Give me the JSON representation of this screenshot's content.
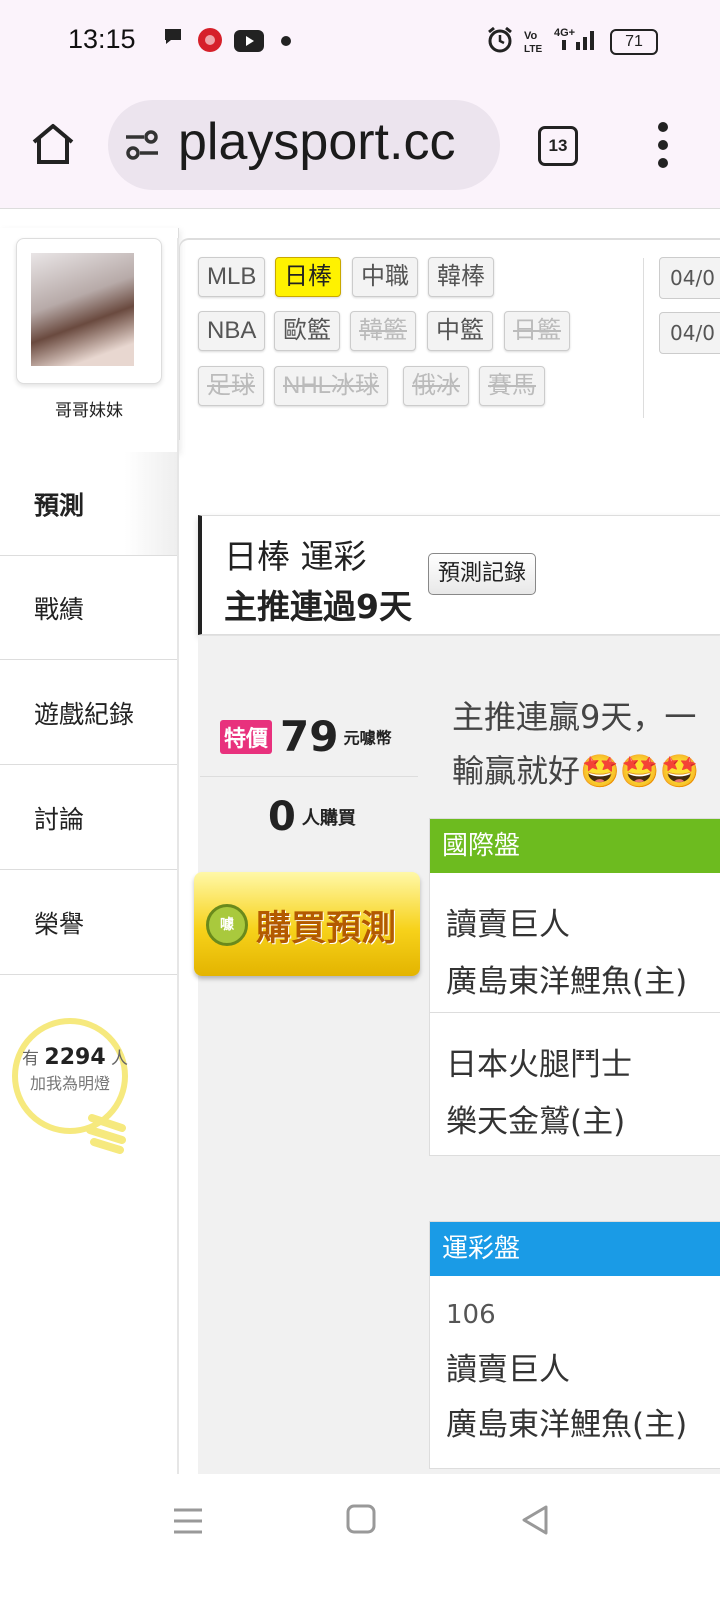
{
  "status": {
    "time": "13:15",
    "battery": "71"
  },
  "browser": {
    "url": "playsport.cc",
    "tab_count": "13"
  },
  "profile": {
    "name": "哥哥妹妹"
  },
  "nav": [
    {
      "label": "預測"
    },
    {
      "label": "戰績"
    },
    {
      "label": "遊戲紀錄"
    },
    {
      "label": "討論"
    },
    {
      "label": "榮譽"
    }
  ],
  "fans": {
    "prefix": "有",
    "count": "2294",
    "suffix": "人",
    "caption": "加我為明燈"
  },
  "filters": {
    "row1": [
      "MLB",
      "日棒",
      "中職",
      "韓棒"
    ],
    "row2": [
      "NBA",
      "歐籃",
      "韓籃",
      "中籃",
      "日籃"
    ],
    "row3": [
      "足球",
      "NHL冰球",
      "俄冰",
      "賽馬"
    ],
    "dates": [
      "04/0",
      "04/0"
    ]
  },
  "title": {
    "line1": "日棒 運彩",
    "line2": "主推連過9天",
    "record_button": "預測記錄"
  },
  "offer": {
    "badge": "特價",
    "price": "79",
    "unit": "元噱幣",
    "buyers": "0",
    "buyers_unit": "人購買",
    "buy_button": "購買預測",
    "coin": "噱"
  },
  "description": {
    "line1": "主推連贏9天，一",
    "line2": "輸贏就好"
  },
  "panels": {
    "international": {
      "header": "國際盤",
      "header_color": "#6dbb1f",
      "games": [
        {
          "away": "讀賣巨人",
          "home": "廣島東洋鯉魚(主)"
        },
        {
          "away": "日本火腿鬥士",
          "home": "樂天金鷲(主)"
        }
      ]
    },
    "lottery": {
      "header": "運彩盤",
      "header_color": "#1a9be6",
      "number": "106",
      "away": "讀賣巨人",
      "home": "廣島東洋鯉魚(主)"
    }
  }
}
